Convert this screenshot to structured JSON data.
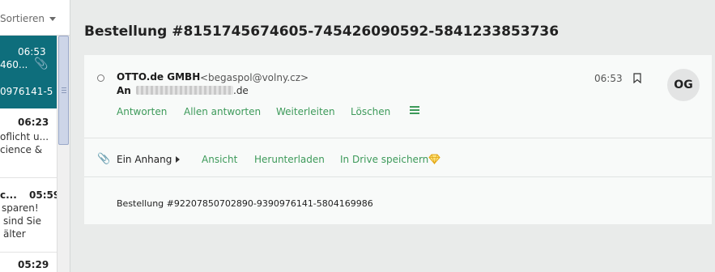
{
  "list": {
    "sort_label": "Sortieren",
    "items": [
      {
        "time": "06:53",
        "line2": "460...",
        "line3": "0976141-5"
      },
      {
        "time": "06:23",
        "line2": "oflicht u...",
        "line3": "cience &"
      },
      {
        "from": "c...",
        "time": "05:59",
        "line2": "sparen!",
        "line3": "sind Sie",
        "line4": "älter"
      },
      {
        "time": "05:29"
      }
    ]
  },
  "message": {
    "subject": "Bestellung #8151745674605-745426090592-5841233853736",
    "sender_name": "OTTO.de GMBH",
    "sender_email": "<begaspol@volny.cz>",
    "to_label": "An",
    "to_suffix": ".de",
    "time": "06:53",
    "avatar_initials": "OG",
    "actions": {
      "reply": "Antworten",
      "reply_all": "Allen antworten",
      "forward": "Weiterleiten",
      "delete": "Löschen"
    },
    "attachment": {
      "label": "Ein Anhang",
      "view": "Ansicht",
      "download": "Herunterladen",
      "save_drive": "In Drive speichern"
    },
    "body": "Bestellung #92207850702890-9390976141-5804169986"
  },
  "colors": {
    "accent_green": "#3d9a5a",
    "selected_item": "#0e6e7c",
    "background": "#e9ebea",
    "card": "#f8faf9"
  },
  "icons": [
    "chevron-down-icon",
    "paperclip-icon",
    "unread-dot-icon",
    "bookmark-icon",
    "menu-icon",
    "caret-right-icon",
    "diamond-icon"
  ]
}
